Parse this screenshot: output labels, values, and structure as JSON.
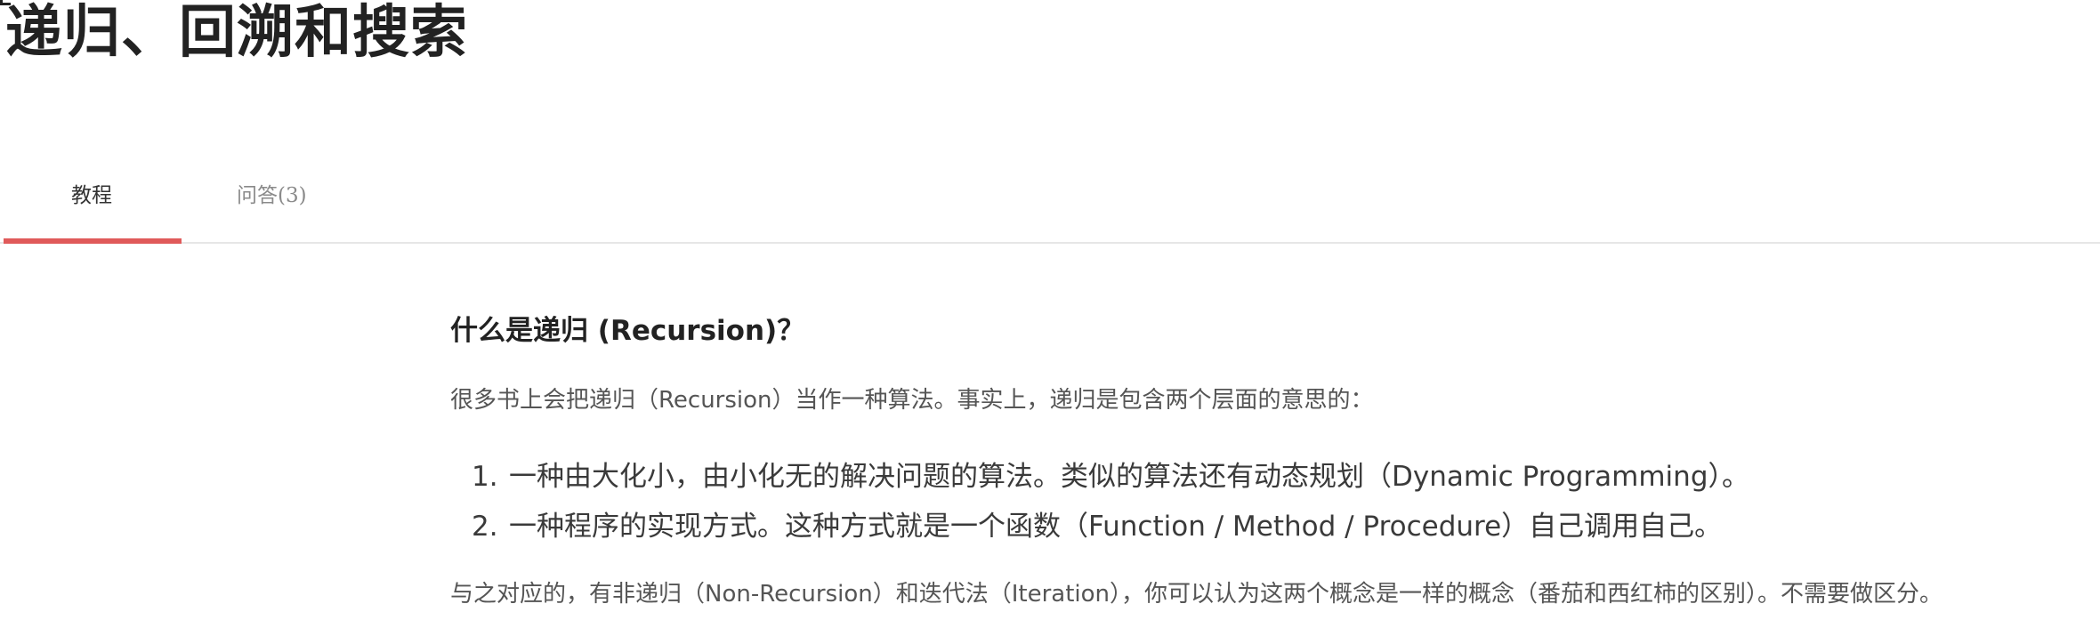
{
  "page": {
    "title": "递归、回溯和搜索"
  },
  "tabs": [
    {
      "label": "教程",
      "active": true
    },
    {
      "label": "问答(3)",
      "active": false
    }
  ],
  "colors": {
    "active_tab_underline": "#e05a5a",
    "tab_divider": "#e6e6e6",
    "title_text": "#222222",
    "body_text": "#555555"
  },
  "article": {
    "heading": "什么是递归 (Recursion)？",
    "intro": "很多书上会把递归（Recursion）当作一种算法。事实上，递归是包含两个层面的意思的：",
    "list": [
      {
        "number": "1.",
        "text": "一种由大化小，由小化无的解决问题的算法。类似的算法还有动态规划（Dynamic Programming）。"
      },
      {
        "number": "2.",
        "text": "一种程序的实现方式。这种方式就是一个函数（Function / Method / Procedure）自己调用自己。"
      }
    ],
    "outro": "与之对应的，有非递归（Non-Recursion）和迭代法（Iteration），你可以认为这两个概念是一样的概念（番茄和西红柿的区别）。不需要做区分。"
  }
}
